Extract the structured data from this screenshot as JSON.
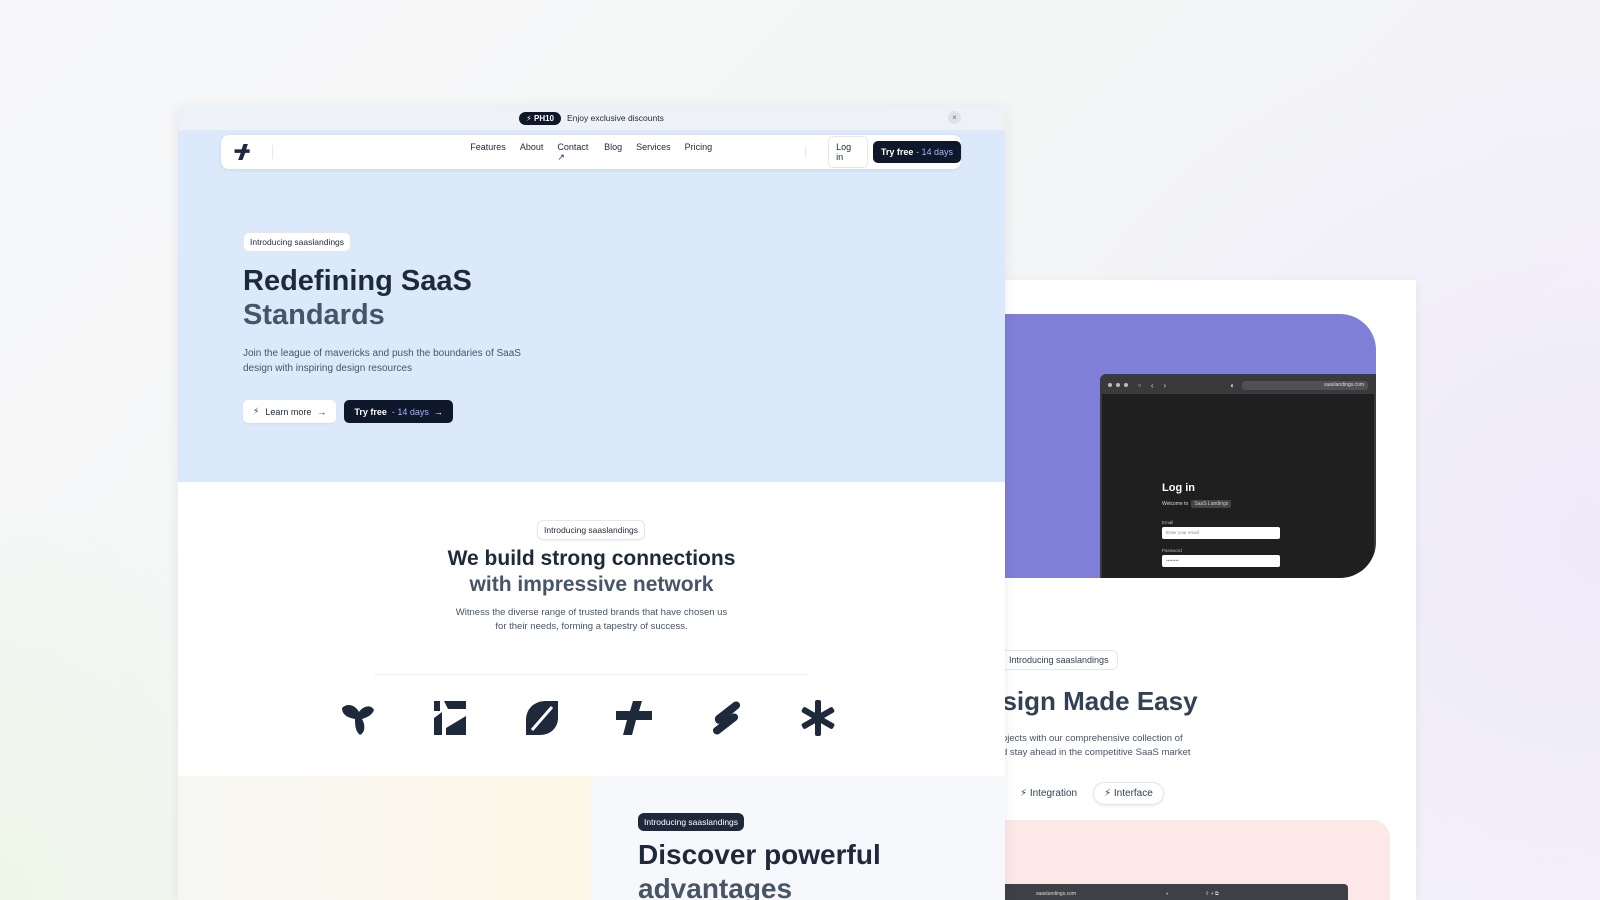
{
  "announcement": {
    "badge": "PH10",
    "text": "Enjoy exclusive discounts",
    "close": "×"
  },
  "nav": {
    "links": [
      "Features",
      "About",
      "Contact ↗",
      "Blog",
      "Services",
      "Pricing"
    ],
    "login": "Log in",
    "try_label": "Try free",
    "try_suffix": "- 14 days"
  },
  "hero": {
    "tag": "Introducing saaslandings",
    "title_line1": "Redefining SaaS",
    "title_line2": "Standards",
    "description": "Join the league of mavericks and push the boundaries of SaaS design with inspiring design resources",
    "learn_more": "Learn more",
    "try_label": "Try free",
    "try_suffix": "- 14 days"
  },
  "network": {
    "tag": "Introducing saaslandings",
    "title_line1": "We build strong connections",
    "title_line2": "with impressive network",
    "description_line1": "Witness the diverse range of trusted brands that have chosen us",
    "description_line2": "for their needs, forming a tapestry of success.",
    "logos": [
      "brand-logo-1",
      "brand-logo-2",
      "brand-logo-3",
      "brand-logo-4",
      "brand-logo-5",
      "brand-logo-6"
    ]
  },
  "advantages": {
    "tag": "Introducing saaslandings",
    "title_line1": "Discover powerful",
    "title_line2": "advantages"
  },
  "back_card": {
    "login_title": "Log in",
    "welcome": "Welcome to",
    "welcome_tag": "SaaS Landings",
    "email_label": "Email",
    "email_placeholder": "Enter your email",
    "password_label": "Password",
    "password_value": "••••••••",
    "url": "saaslandings.com",
    "tag": "Introducing saaslandings",
    "title": "esign Made Easy",
    "desc_line1": "ojects with our comprehensive collection of",
    "desc_line2": "d stay ahead in the competitive SaaS market",
    "tabs": [
      "Integration",
      "Interface"
    ],
    "bottom_url": "saaslandings.com"
  },
  "colors": {
    "hero_bg": "#dbe9fb",
    "primary": "#0f172a",
    "purple_panel": "#7f7fd8",
    "pink_panel": "#fde8e8"
  }
}
